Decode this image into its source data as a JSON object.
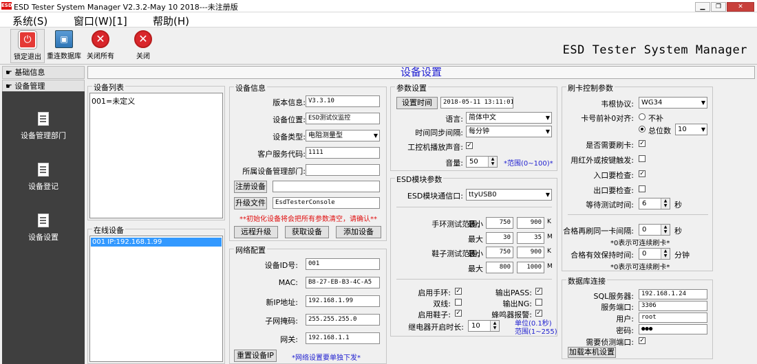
{
  "window": {
    "title": "ESD Tester System Manager V2.3.2-May 10 2018---未注册版",
    "logo": "ESD"
  },
  "menu": [
    "系统(S)",
    "窗口(W)[1]",
    "帮助(H)"
  ],
  "toolbar": {
    "lock_exit": "锁定退出",
    "reconnect_db": "重连数据库",
    "close_all": "关闭所有",
    "close": "关闭"
  },
  "app_title": "ESD Tester System Manager",
  "sidebar": {
    "basic_info": "基础信息",
    "device_mgmt": "设备管理",
    "items": [
      "设备管理部门",
      "设备登记",
      "设备设置"
    ]
  },
  "page_title": "设备设置",
  "device_list": {
    "title": "设备列表",
    "items": [
      "001=未定义"
    ]
  },
  "online_devices": {
    "title": "在线设备",
    "items": [
      "001  IP:192.168.1.99"
    ]
  },
  "device_info": {
    "title": "设备信息",
    "version_label": "版本信息:",
    "version": "V3.3.10",
    "location_label": "设备位置:",
    "location": "ESD测试仪监控",
    "type_label": "设备类型:",
    "type": "电阻测量型",
    "service_code_label": "客户服务代码:",
    "service_code": "1111",
    "dept_label": "所属设备管理部门:",
    "dept": "",
    "register_btn": "注册设备",
    "register_value": "",
    "upgrade_btn": "升级文件",
    "upgrade_value": "EsdTesterConsole",
    "warning": "**初始化设备将会把所有参数清空，请确认**",
    "remote_upgrade": "远程升级",
    "fetch_device": "获取设备",
    "add_device": "添加设备"
  },
  "network": {
    "title": "网络配置",
    "id_label": "设备ID号:",
    "id": "001",
    "mac_label": "MAC:",
    "mac": "B8-27-EB-B3-4C-A5",
    "ip_label": "新IP地址:",
    "ip": "192.168.1.99",
    "mask_label": "子网掩码:",
    "mask": "255.255.255.0",
    "gateway_label": "网关:",
    "gateway": "192.168.1.1",
    "reset_ip_btn": "重置设备IP",
    "note": "*网络设置要单独下发*"
  },
  "params": {
    "title": "参数设置",
    "set_time_btn": "设置时间",
    "time": "2018-05-11  13:11:01",
    "language_label": "语言:",
    "language": "简体中文",
    "sync_label": "时间同步间隔:",
    "sync": "每分钟",
    "sound_label": "工控机播放声音:",
    "volume_label": "音量:",
    "volume": "50",
    "volume_range": "*范围(0~100)*"
  },
  "esd": {
    "title": "ESD模块参数",
    "port_label": "ESD模块通信口:",
    "port": "ttyUSB0",
    "wrist_label": "手环测试范围:",
    "wrist_min_label": "最小",
    "wrist_min": "750",
    "wrist_min2": "900",
    "wrist_min_unit": "K",
    "wrist_max_label": "最大",
    "wrist_max": "30",
    "wrist_max2": "35",
    "wrist_max_unit": "M",
    "shoe_label": "鞋子测试范围:",
    "shoe_min_label": "最小",
    "shoe_min": "750",
    "shoe_min2": "900",
    "shoe_min_unit": "K",
    "shoe_max_label": "最大",
    "shoe_max": "800",
    "shoe_max2": "1000",
    "shoe_max_unit": "M",
    "enable_wrist": "启用手环:",
    "dual_line": "双线:",
    "enable_shoe": "启用鞋子:",
    "output_pass": "输出PASS:",
    "output_ng": "输出NG:",
    "buzzer": "蜂鸣器报警:",
    "relay_label": "继电器开启时长:",
    "relay": "10",
    "relay_unit": "单位(0.1秒)",
    "relay_range": "范围(1~255)"
  },
  "card": {
    "title": "刷卡控制参数",
    "wiegand_label": "韦根协议:",
    "wiegand": "WG34",
    "pad_label": "卡号前补0对齐:",
    "no_pad": "不补",
    "total_digits": "总位数",
    "digits": "10",
    "need_card": "是否需要刷卡:",
    "ir_trigger": "用红外或按键触发:",
    "entry_check": "入口要检查:",
    "exit_check": "出口要检查:",
    "wait_label": "等待测试时间:",
    "wait": "6",
    "wait_unit": "秒",
    "interval_label": "合格再刷同一卡间隔:",
    "interval": "0",
    "interval_unit": "秒",
    "interval_note": "*0表示可连续刷卡*",
    "valid_label": "合格有效保持时间:",
    "valid": "0",
    "valid_unit": "分钟",
    "valid_note": "*0表示可连续刷卡*"
  },
  "database": {
    "title": "数据库连接",
    "server_label": "SQL服务器:",
    "server": "192.168.1.24",
    "port_label": "服务端口:",
    "port": "3306",
    "user_label": "用户:",
    "user": "root",
    "pwd_label": "密码:",
    "pwd": "●●●",
    "detect_label": "需要侦测端口:",
    "load_btn": "加载本机设置"
  }
}
